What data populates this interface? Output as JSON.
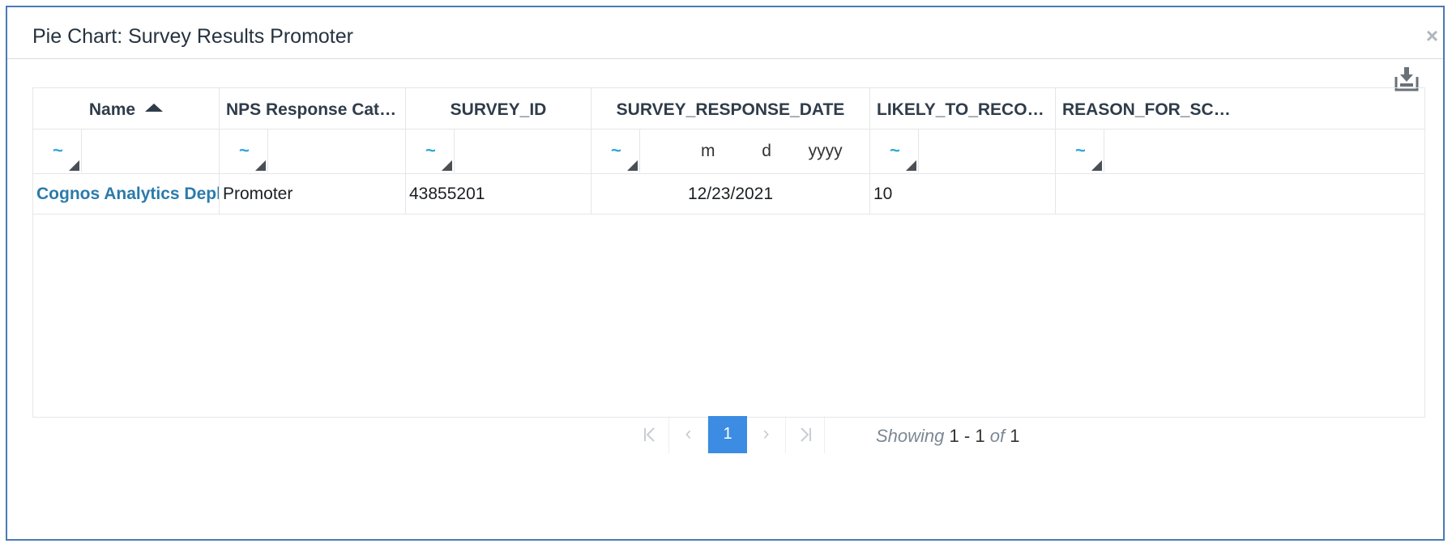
{
  "dialog": {
    "title": "Pie Chart: Survey Results Promoter",
    "close_label": "×",
    "export_icon": "download-tray-icon"
  },
  "grid": {
    "columns": [
      {
        "label": "Name",
        "sort": "ascending"
      },
      {
        "label": "NPS Response Categ..."
      },
      {
        "label": "SURVEY_ID"
      },
      {
        "label": "SURVEY_RESPONSE_DATE"
      },
      {
        "label": "LIKELY_TO_RECOMM..."
      },
      {
        "label": "REASON_FOR_SCORE"
      }
    ],
    "filter_operator": "~",
    "date_filter": {
      "month": "m",
      "day": "d",
      "year": "yyyy"
    },
    "rows": [
      {
        "name": "Cognos Analytics Deployr",
        "nps_category": "Promoter",
        "survey_id": "43855201",
        "response_date": "12/23/2021",
        "likely_to_recommend": "10",
        "reason": ""
      }
    ]
  },
  "pager": {
    "first": "⏮",
    "prev": "‹",
    "current_page": "1",
    "next": "›",
    "last": "⏭",
    "showing_label": "Showing",
    "range_from": "1",
    "range_sep": "-",
    "range_to": "1",
    "of_label": "of",
    "total": "1"
  }
}
